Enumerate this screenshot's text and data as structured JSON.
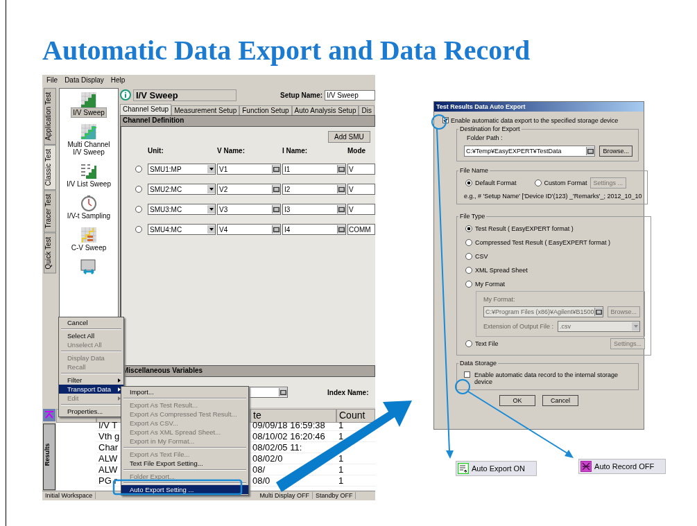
{
  "slide_title": "Automatic Data Export and Data Record",
  "app": {
    "menu_bar": [
      "File",
      "Data Display",
      "Help"
    ],
    "side_tabs": [
      {
        "label": "Application Test",
        "selected": false
      },
      {
        "label": "Classic Test",
        "selected": true
      },
      {
        "label": "Tracer Test",
        "selected": false
      },
      {
        "label": "Quick Test",
        "selected": false
      }
    ],
    "test_list": [
      {
        "label": "I/V Sweep",
        "kind": "sweep",
        "selected": true
      },
      {
        "label": "Multi Channel I/V Sweep",
        "kind": "multi",
        "selected": false
      },
      {
        "label": "I/V List Sweep",
        "kind": "list",
        "selected": false
      },
      {
        "label": "I/V-t Sampling",
        "kind": "clock",
        "selected": false
      },
      {
        "label": "C-V Sweep",
        "kind": "cv",
        "selected": false
      },
      {
        "kind": "switch",
        "selected": false
      }
    ],
    "setup": {
      "title": "I/V Sweep",
      "name_label": "Setup Name:",
      "name": "I/V Sweep"
    },
    "tabs": [
      {
        "label": "Channel Setup",
        "selected": true
      },
      {
        "label": "Measurement Setup",
        "selected": false
      },
      {
        "label": "Function Setup",
        "selected": false
      },
      {
        "label": "Auto Analysis Setup",
        "selected": false
      },
      {
        "label": "Dis",
        "selected": false
      }
    ],
    "channel_definition": {
      "heading": "Channel Definition",
      "add_button": "Add SMU",
      "columns": [
        "Unit:",
        "V Name:",
        "I Name:",
        "Mode"
      ],
      "rows": [
        {
          "unit": "SMU1:MP",
          "v_name": "V1",
          "i_name": "I1",
          "mode": "V",
          "selected": false
        },
        {
          "unit": "SMU2:MC",
          "v_name": "V2",
          "i_name": "I2",
          "mode": "V",
          "selected": false
        },
        {
          "unit": "SMU3:MC",
          "v_name": "V3",
          "i_name": "I3",
          "mode": "V",
          "selected": false
        },
        {
          "unit": "SMU4:MC",
          "v_name": "V4",
          "i_name": "I4",
          "mode": "COMM",
          "selected": false
        }
      ]
    },
    "misc": {
      "heading": "Miscellaneous Variables",
      "index_label": "Index Name:"
    },
    "results": {
      "side_label": "Results",
      "columns": [
        "te",
        "Count"
      ],
      "rows": [
        {
          "name": "I/V T",
          "date": "09/09/18 16:59:38",
          "count": "1"
        },
        {
          "name": "Vth g",
          "date": "08/10/02 16:20:46",
          "count": "1"
        },
        {
          "name": "Char",
          "date": "08/02/05 11:"
        },
        {
          "name": "ALW",
          "date": "08/02/0",
          "count": "1"
        },
        {
          "name": "ALW",
          "date": "08/",
          "count": "1"
        },
        {
          "name": "PG r",
          "date": "08/0",
          "count": "1"
        }
      ]
    },
    "status_bar": [
      "Initial Workspace",
      "Multi Display OFF",
      "Standby OFF"
    ],
    "context_menu": [
      [
        {
          "label": "Cancel",
          "disabled": false,
          "selected": false,
          "submenu": false
        }
      ],
      [
        {
          "label": "Select All",
          "disabled": false,
          "selected": false,
          "submenu": false
        },
        {
          "label": "Unselect All",
          "disabled": true,
          "selected": false,
          "submenu": false
        }
      ],
      [
        {
          "label": "Display Data",
          "disabled": true,
          "selected": false,
          "submenu": false
        },
        {
          "label": "Recall",
          "disabled": true,
          "selected": false,
          "submenu": false
        }
      ],
      [
        {
          "label": "Filter",
          "disabled": false,
          "selected": false,
          "submenu": true
        },
        {
          "label": "Transport Data",
          "disabled": false,
          "selected": true,
          "submenu": true
        },
        {
          "label": "Edit",
          "disabled": true,
          "selected": false,
          "submenu": true
        }
      ],
      [
        {
          "label": "Properties...",
          "disabled": false,
          "selected": false,
          "submenu": false
        }
      ]
    ],
    "submenu": [
      [
        {
          "label": "Import...",
          "disabled": false,
          "selected": false
        }
      ],
      [
        {
          "label": "Export As Test Result...",
          "disabled": true,
          "selected": false
        },
        {
          "label": "Export As Compressed Test Result...",
          "disabled": true,
          "selected": false
        },
        {
          "label": "Export As CSV...",
          "disabled": true,
          "selected": false
        },
        {
          "label": "Export As XML Spread Sheet...",
          "disabled": true,
          "selected": false
        },
        {
          "label": "Export in My Format...",
          "disabled": true,
          "selected": false
        }
      ],
      [
        {
          "label": "Export As Text File...",
          "disabled": true,
          "selected": false
        },
        {
          "label": "Text File Export Setting...",
          "disabled": false,
          "selected": false
        }
      ],
      [
        {
          "label": "Folder Export...",
          "disabled": true,
          "selected": false
        }
      ],
      [
        {
          "label": "Auto Export Setting ...",
          "disabled": false,
          "selected": true
        }
      ]
    ]
  },
  "dialog": {
    "title": "Test Results Data Auto Export",
    "enable_export": {
      "label": "Enable automatic data export to the specified storage device",
      "checked": true
    },
    "destination": {
      "legend": "Destination for Export",
      "folder_label": "Folder Path :",
      "folder_path": "C:¥Temp¥EasyEXPERT¥TestData",
      "browse": "Browse..."
    },
    "file_name": {
      "legend": "File Name",
      "options": [
        {
          "label": "Default Format",
          "selected": true
        },
        {
          "label": "Custom Format",
          "selected": false
        }
      ],
      "settings": {
        "label": "Settings ...",
        "disabled": true
      },
      "example": "e.g., # 'Setup Name' ['Device ID'(123) _'Remarks'_; 2012_10_10"
    },
    "file_type": {
      "legend": "File Type",
      "options": [
        {
          "label": "Test Result ( EasyEXPERT format )",
          "selected": true,
          "kind": "plain"
        },
        {
          "label": "Compressed Test Result ( EasyEXPERT format )",
          "selected": false,
          "kind": "plain"
        },
        {
          "label": "CSV",
          "selected": false,
          "kind": "plain"
        },
        {
          "label": "XML Spread Sheet",
          "selected": false,
          "kind": "plain"
        },
        {
          "label": "My Format",
          "selected": false,
          "kind": "my_format"
        },
        {
          "label": "Text File",
          "selected": false,
          "kind": "text_file"
        }
      ],
      "my_format": {
        "label": "My Format:",
        "path": "C:¥Program Files (x86)¥Agilent¥B1500",
        "browse": "Browse...",
        "ext_label": "Extension of Output File :",
        "ext": ".csv",
        "disabled": true
      },
      "text_settings": {
        "label": "Settings...",
        "disabled": true
      }
    },
    "data_storage": {
      "legend": "Data Storage",
      "label": "Enable automatic data record to the internal storage device",
      "checked": false
    },
    "buttons": [
      "OK",
      "Cancel"
    ]
  },
  "indicators": [
    {
      "label": "Auto Export ON",
      "kind": "export"
    },
    {
      "label": "Auto Record OFF",
      "kind": "record"
    }
  ]
}
